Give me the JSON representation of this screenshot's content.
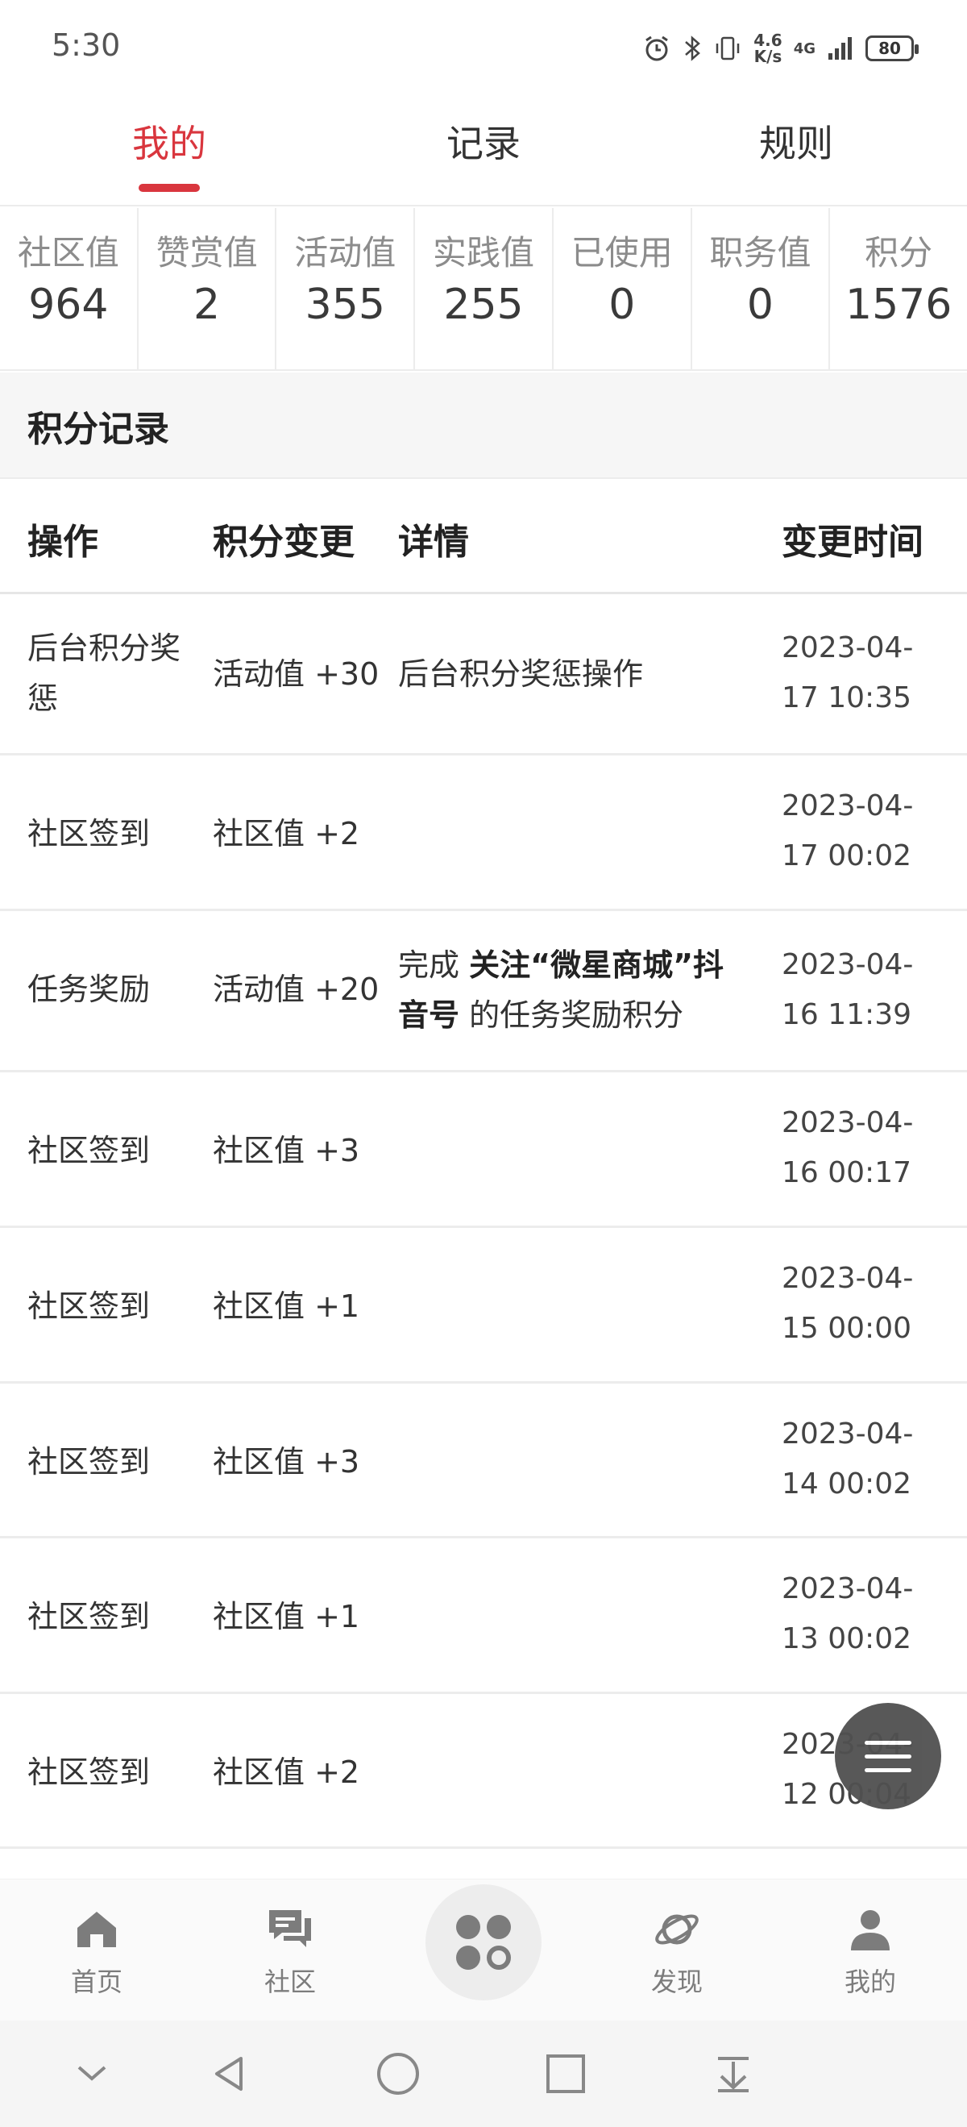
{
  "status_bar": {
    "time": "5:30",
    "net_speed_top": "4.6",
    "net_speed_bottom": "K/s",
    "network": "4G",
    "battery": "80"
  },
  "tabs": [
    {
      "label": "我的",
      "active": true
    },
    {
      "label": "记录",
      "active": false
    },
    {
      "label": "规则",
      "active": false
    }
  ],
  "stats": [
    {
      "label": "社区值",
      "value": "964"
    },
    {
      "label": "赞赏值",
      "value": "2"
    },
    {
      "label": "活动值",
      "value": "355"
    },
    {
      "label": "实践值",
      "value": "255"
    },
    {
      "label": "已使用",
      "value": "0"
    },
    {
      "label": "职务值",
      "value": "0"
    },
    {
      "label": "积分",
      "value": "1576"
    }
  ],
  "section_title": "积分记录",
  "table": {
    "headers": {
      "operation": "操作",
      "change": "积分变更",
      "detail": "详情",
      "time": "变更时间"
    },
    "rows": [
      {
        "op": "后台积分奖惩",
        "change": "活动值 +30",
        "detail_pre": "后台积分奖惩操作",
        "detail_bold": "",
        "detail_post": "",
        "date": "2023-04-",
        "clock": "17 10:35"
      },
      {
        "op": "社区签到",
        "change": "社区值 +2",
        "detail_pre": "",
        "detail_bold": "",
        "detail_post": "",
        "date": "2023-04-",
        "clock": "17 00:02"
      },
      {
        "op": "任务奖励",
        "change": "活动值 +20",
        "detail_pre": "完成 ",
        "detail_bold": "关注“微星商城”抖音号",
        "detail_post": " 的任务奖励积分",
        "date": "2023-04-",
        "clock": "16 11:39"
      },
      {
        "op": "社区签到",
        "change": "社区值 +3",
        "detail_pre": "",
        "detail_bold": "",
        "detail_post": "",
        "date": "2023-04-",
        "clock": "16 00:17"
      },
      {
        "op": "社区签到",
        "change": "社区值 +1",
        "detail_pre": "",
        "detail_bold": "",
        "detail_post": "",
        "date": "2023-04-",
        "clock": "15 00:00"
      },
      {
        "op": "社区签到",
        "change": "社区值 +3",
        "detail_pre": "",
        "detail_bold": "",
        "detail_post": "",
        "date": "2023-04-",
        "clock": "14 00:02"
      },
      {
        "op": "社区签到",
        "change": "社区值 +1",
        "detail_pre": "",
        "detail_bold": "",
        "detail_post": "",
        "date": "2023-04-",
        "clock": "13 00:02"
      },
      {
        "op": "社区签到",
        "change": "社区值 +2",
        "detail_pre": "",
        "detail_bold": "",
        "detail_post": "",
        "date": "2023-04-",
        "clock": "12 00:04"
      }
    ]
  },
  "bottom_nav": [
    {
      "label": "首页",
      "icon": "home-icon"
    },
    {
      "label": "社区",
      "icon": "community-icon"
    },
    {
      "label": "",
      "icon": "apps-icon"
    },
    {
      "label": "发现",
      "icon": "planet-icon"
    },
    {
      "label": "我的",
      "icon": "user-icon"
    }
  ],
  "colors": {
    "accent": "#d9363e",
    "divider": "#ececec",
    "muted": "#8c8c8c"
  }
}
